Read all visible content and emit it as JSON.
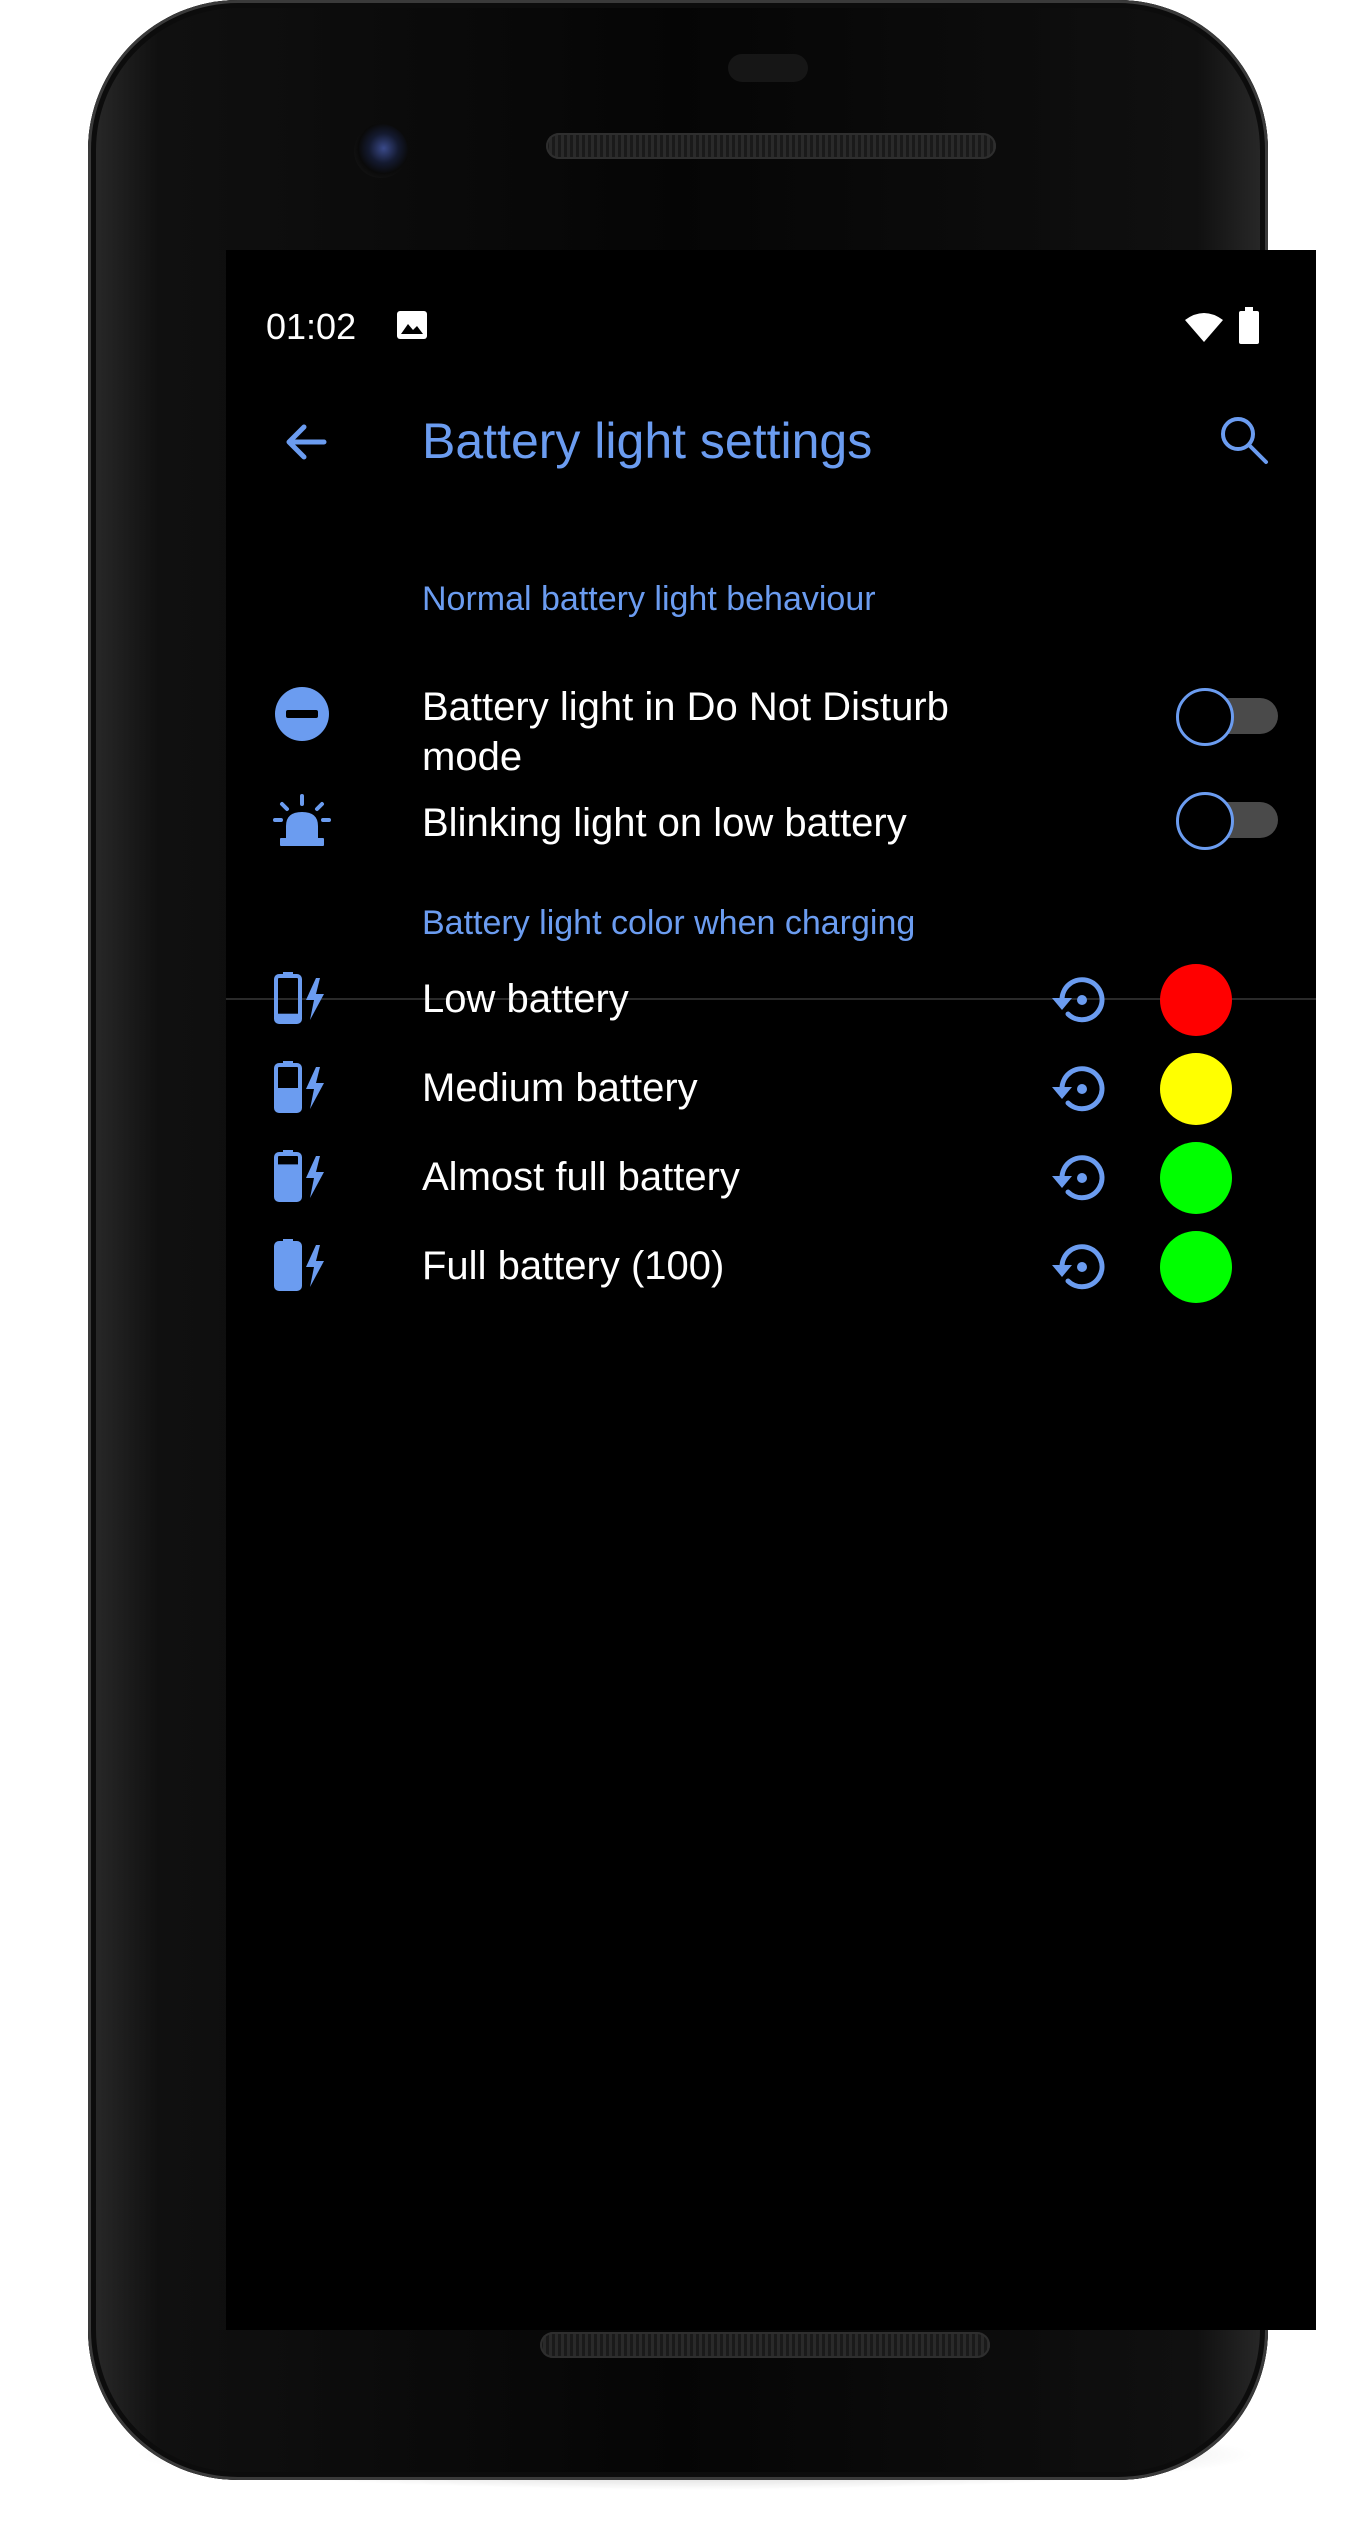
{
  "status_bar": {
    "time": "01:02",
    "icons": [
      "image-icon",
      "wifi-icon",
      "battery-icon"
    ]
  },
  "app_bar": {
    "title": "Battery light settings",
    "back_icon": "arrow-back-icon",
    "search_icon": "search-icon"
  },
  "colors": {
    "accent": "#6b9cf0",
    "background": "#000000",
    "text": "#ffffff"
  },
  "sections": [
    {
      "header": "Normal battery light behaviour",
      "items": [
        {
          "label": "Battery light in Do Not Disturb mode",
          "icon": "do-not-disturb-icon",
          "toggle_on": false
        },
        {
          "label": "Blinking light on low battery",
          "icon": "siren-icon",
          "toggle_on": false
        }
      ]
    },
    {
      "header": "Battery light color when charging",
      "items": [
        {
          "label": "Low battery",
          "icon": "battery-charging-low-icon",
          "reset_icon": "reset-icon",
          "color": "#ff0000",
          "level": 0.15
        },
        {
          "label": "Medium battery",
          "icon": "battery-charging-medium-icon",
          "reset_icon": "reset-icon",
          "color": "#ffff00",
          "level": 0.5
        },
        {
          "label": "Almost full battery",
          "icon": "battery-charging-almost-full-icon",
          "reset_icon": "reset-icon",
          "color": "#00ff00",
          "level": 0.8
        },
        {
          "label": "Full battery (100)",
          "icon": "battery-charging-full-icon",
          "reset_icon": "reset-icon",
          "color": "#00ff00",
          "level": 1.0
        }
      ]
    }
  ]
}
